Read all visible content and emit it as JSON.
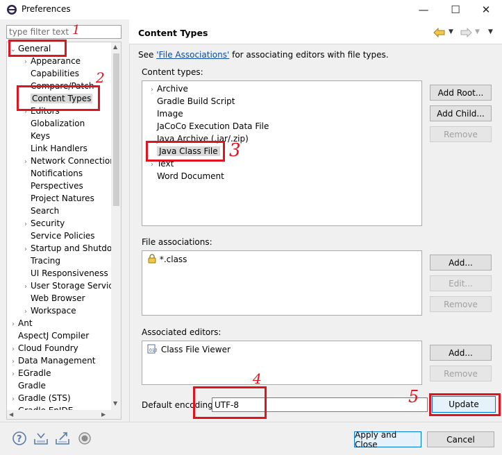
{
  "window": {
    "title": "Preferences",
    "minimize_glyph": "—",
    "maximize_glyph": "☐",
    "close_glyph": "✕"
  },
  "left": {
    "filter_placeholder": "type filter text",
    "tree": [
      {
        "label": "General",
        "indent": 0,
        "twisty": "expanded"
      },
      {
        "label": "Appearance",
        "indent": 1,
        "twisty": "collapsed"
      },
      {
        "label": "Capabilities",
        "indent": 1,
        "twisty": "none"
      },
      {
        "label": "Compare/Patch",
        "indent": 1,
        "twisty": "none"
      },
      {
        "label": "Content Types",
        "indent": 1,
        "twisty": "none",
        "selected": true
      },
      {
        "label": "Editors",
        "indent": 1,
        "twisty": "collapsed"
      },
      {
        "label": "Globalization",
        "indent": 1,
        "twisty": "none"
      },
      {
        "label": "Keys",
        "indent": 1,
        "twisty": "none"
      },
      {
        "label": "Link Handlers",
        "indent": 1,
        "twisty": "none"
      },
      {
        "label": "Network Connections",
        "indent": 1,
        "twisty": "collapsed"
      },
      {
        "label": "Notifications",
        "indent": 1,
        "twisty": "none"
      },
      {
        "label": "Perspectives",
        "indent": 1,
        "twisty": "none"
      },
      {
        "label": "Project Natures",
        "indent": 1,
        "twisty": "none"
      },
      {
        "label": "Search",
        "indent": 1,
        "twisty": "none"
      },
      {
        "label": "Security",
        "indent": 1,
        "twisty": "collapsed"
      },
      {
        "label": "Service Policies",
        "indent": 1,
        "twisty": "none"
      },
      {
        "label": "Startup and Shutdown",
        "indent": 1,
        "twisty": "collapsed"
      },
      {
        "label": "Tracing",
        "indent": 1,
        "twisty": "none"
      },
      {
        "label": "UI Responsiveness Monitoring",
        "indent": 1,
        "twisty": "none"
      },
      {
        "label": "User Storage Service",
        "indent": 1,
        "twisty": "collapsed"
      },
      {
        "label": "Web Browser",
        "indent": 1,
        "twisty": "none"
      },
      {
        "label": "Workspace",
        "indent": 1,
        "twisty": "collapsed"
      },
      {
        "label": "Ant",
        "indent": 0,
        "twisty": "collapsed"
      },
      {
        "label": "AspectJ Compiler",
        "indent": 0,
        "twisty": "none"
      },
      {
        "label": "Cloud Foundry",
        "indent": 0,
        "twisty": "collapsed"
      },
      {
        "label": "Data Management",
        "indent": 0,
        "twisty": "collapsed"
      },
      {
        "label": "EGradle",
        "indent": 0,
        "twisty": "collapsed"
      },
      {
        "label": "Gradle",
        "indent": 0,
        "twisty": "none"
      },
      {
        "label": "Gradle (STS)",
        "indent": 0,
        "twisty": "collapsed"
      },
      {
        "label": "Gradle EnIDE",
        "indent": 0,
        "twisty": "collapsed"
      }
    ]
  },
  "right": {
    "page_title": "Content Types",
    "intro_prefix": "See ",
    "intro_link": "'File Associations'",
    "intro_suffix": " for associating editors with file types.",
    "content_types_label": "Content types:",
    "content_types": [
      {
        "label": "Archive",
        "twisty": "collapsed"
      },
      {
        "label": "Gradle Build Script",
        "twisty": "none"
      },
      {
        "label": "Image",
        "twisty": "none"
      },
      {
        "label": "JaCoCo Execution Data File",
        "twisty": "none"
      },
      {
        "label": "Java Archive (.jar/.zip)",
        "twisty": "none"
      },
      {
        "label": "Java Class File",
        "twisty": "none",
        "selected": true
      },
      {
        "label": "Text",
        "twisty": "collapsed"
      },
      {
        "label": "Word Document",
        "twisty": "none"
      }
    ],
    "ct_buttons": {
      "add_root": "Add Root...",
      "add_child": "Add Child...",
      "remove": "Remove"
    },
    "file_assoc_label": "File associations:",
    "file_assoc_items": [
      "*.class"
    ],
    "fa_buttons": {
      "add": "Add...",
      "edit": "Edit...",
      "remove": "Remove"
    },
    "assoc_editors_label": "Associated editors:",
    "assoc_editors_items": [
      "Class File Viewer"
    ],
    "ae_buttons": {
      "add": "Add...",
      "remove": "Remove"
    },
    "default_encoding_label": "Default encoding:",
    "default_encoding_value": "UTF-8",
    "update_label": "Update"
  },
  "bottom": {
    "apply_close": "Apply and Close",
    "cancel": "Cancel"
  },
  "annotations": [
    "1",
    "2",
    "3",
    "4",
    "5"
  ],
  "colors": {
    "annotation_red": "#e0141e",
    "link_blue": "#0b4aa6",
    "selection_grey": "#d9d9d9",
    "primary_border": "#0078d7"
  }
}
